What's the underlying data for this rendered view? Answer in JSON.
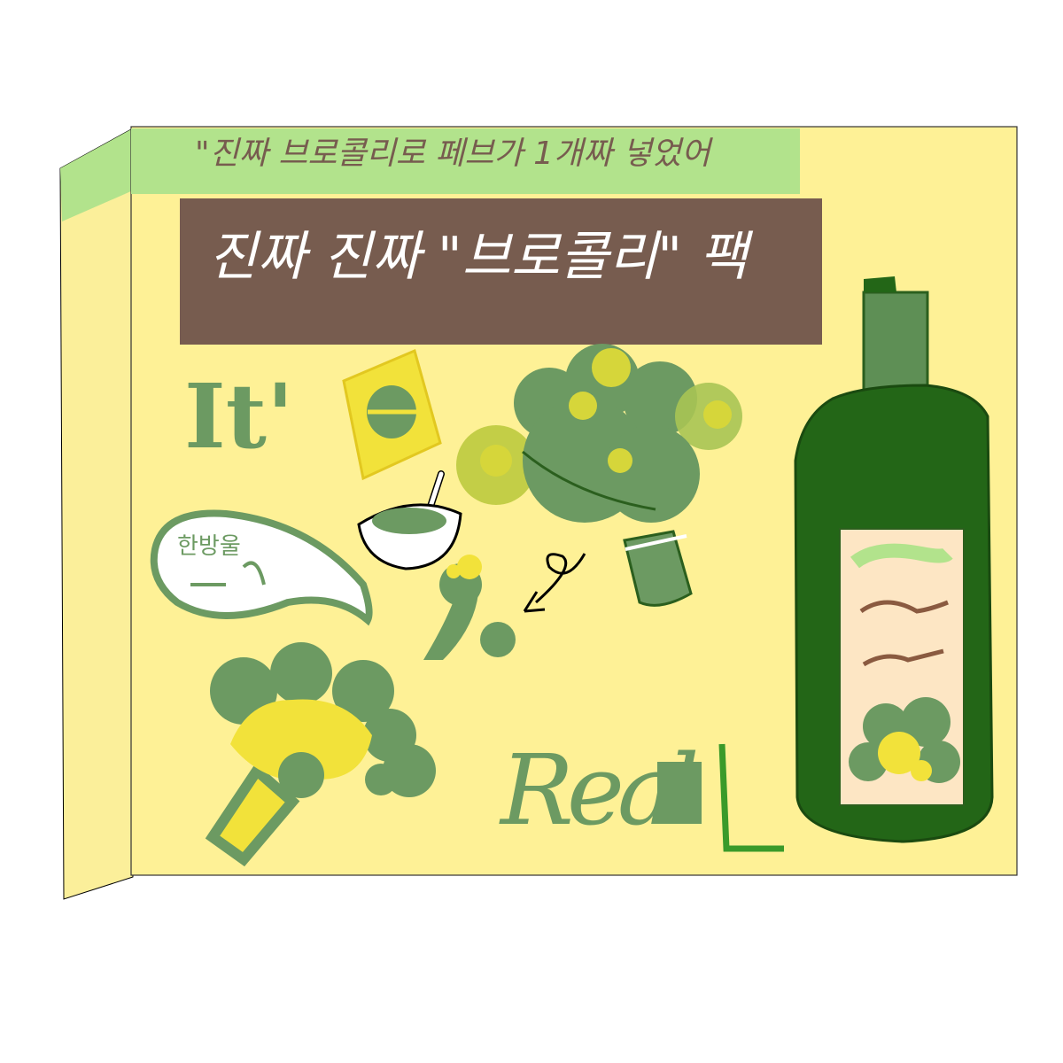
{
  "colors": {
    "box_front": "#fef196",
    "box_side": "#fbef9a",
    "top_band": "#b2e38c",
    "brown_banner": "#775c4f",
    "sage": "#6c9a62",
    "dark_green": "#2b5f1e",
    "bottle": "#236617",
    "bottle_neck": "#5e8f55",
    "label": "#fde6c4",
    "yellow": "#f2e23a",
    "tan": "#c4a06a",
    "white": "#ffffff"
  },
  "texts": {
    "top_band_text": "\"진짜 브로콜리로 페브가 1개짜 넣었어",
    "banner_text": "진짜 진짜 \"브로콜리\" 팩",
    "its_text": "It'",
    "speech_text": "한방울",
    "real_text": "Real"
  },
  "icons": {
    "sachet": "sachet-icon",
    "bowl": "bowl-icon",
    "arrow": "curly-arrow-icon",
    "bottle": "bottle-icon"
  }
}
